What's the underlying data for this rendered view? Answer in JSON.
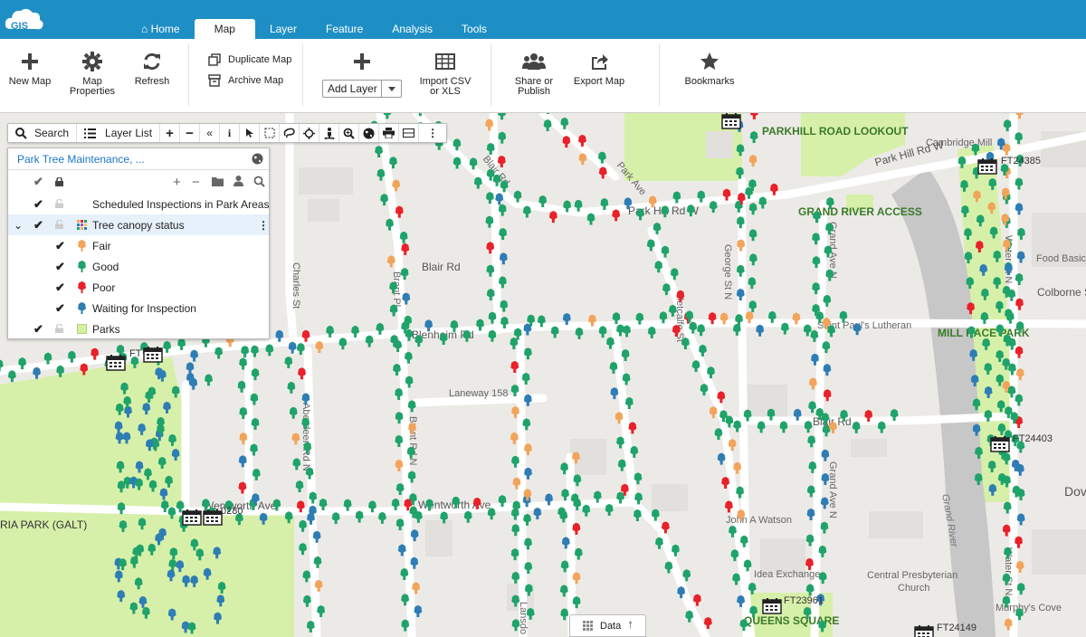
{
  "app": {
    "logo_text": "GIS"
  },
  "tabs": [
    {
      "label": "Home",
      "icon": "home-icon"
    },
    {
      "label": "Map",
      "active": true
    },
    {
      "label": "Layer"
    },
    {
      "label": "Feature"
    },
    {
      "label": "Analysis"
    },
    {
      "label": "Tools"
    }
  ],
  "ribbon": {
    "new_map": "New Map",
    "map_properties_1": "Map",
    "map_properties_2": "Properties",
    "refresh": "Refresh",
    "duplicate_map": "Duplicate Map",
    "archive_map": "Archive Map",
    "add_layer": "Add Layer",
    "import_1": "Import CSV",
    "import_2": "or XLS",
    "share_1": "Share or",
    "share_2": "Publish",
    "export_map": "Export Map",
    "bookmarks": "Bookmarks"
  },
  "toolbar": {
    "search": "Search",
    "layer_list": "Layer List"
  },
  "layer_panel": {
    "title": "Park Tree Maintenance, ...",
    "layers": [
      {
        "label": "Scheduled Inspections in Park Areas"
      },
      {
        "label": "Tree canopy status",
        "selected": true
      },
      {
        "label": "Fair",
        "color": "#f2a45a"
      },
      {
        "label": "Good",
        "color": "#1fa36a"
      },
      {
        "label": "Poor",
        "color": "#e8212a"
      },
      {
        "label": "Waiting for Inspection",
        "color": "#2e7db5"
      },
      {
        "label": "Parks",
        "color": "#d4f0a0"
      }
    ]
  },
  "map_labels": {
    "parkhill_lookout": "PARKHILL ROAD LOOKOUT",
    "grand_river_access": "GRAND RIVER ACCESS",
    "mill_race_park": "MILL RACE PARK",
    "queens_square": "QUEENS SQUARE",
    "ria_park": "RIA PARK (GALT)",
    "cambridge_mill": "Cambridge Mill",
    "food_basics": "Food Basics",
    "colborne": "Colborne St",
    "saint_pauls": "Saint Paul's Lutheran",
    "central_presbyterian_1": "Central Presbyterian",
    "central_presbyterian_2": "Church",
    "idea_exchange": "Idea Exchange",
    "murphys_cove": "Murphy's Cove",
    "john_a_watson": "John A Watson",
    "laneway": "Laneway 158",
    "blenheim": "Blenheim Rd",
    "blair_rd": "Blair Rd",
    "blair_rd_w": "Blair Rd",
    "wentworth": "Wentworth Ave",
    "wentworth_2": "Wentworth Ave",
    "park_hill_w": "Park Hill Rd W",
    "park_hill_e": "Park Hill Rd W",
    "park_ave": "Park Ave",
    "blair_diag": "Blair Rd",
    "george": "George St N",
    "metcalfe": "Metcalfe St",
    "grand_ave_n": "Grand Ave N",
    "grand_ave_n2": "Grand Ave N",
    "charles": "Charles St",
    "brant_pl": "Brant Pl",
    "brant_rd_n": "Brant Rd N",
    "aberdeen": "Aberdeen Rd N",
    "grand_river": "Grand River",
    "water": "Water St N",
    "water_2": "Water St N",
    "ft4385": "FT24385",
    "ft24403": "FT24403",
    "ft23961": "FT23961",
    "ft24149": "FT24149",
    "ft_left": "FT",
    "ft0280": "0280",
    "dov": "Dov",
    "lansdowne": "Lansdo"
  },
  "data_tab": {
    "label": "Data"
  }
}
